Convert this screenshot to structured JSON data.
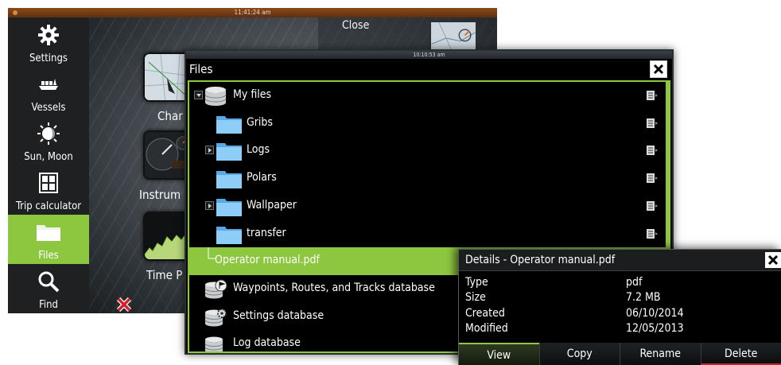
{
  "background_screen": {
    "clock": "11:41:24 am",
    "close_label": "Close",
    "sidebar": [
      {
        "label": "Settings",
        "icon": "gear-icon"
      },
      {
        "label": "Vessels",
        "icon": "vessels-icon"
      },
      {
        "label": "Sun, Moon",
        "icon": "sun-moon-icon"
      },
      {
        "label": "Trip calculator",
        "icon": "calculator-icon"
      },
      {
        "label": "Files",
        "icon": "folder-icon",
        "active": true
      },
      {
        "label": "Find",
        "icon": "search-icon"
      }
    ],
    "tiles": [
      {
        "label": "Char",
        "icon": "chart-tile-icon"
      },
      {
        "label": "Instrum",
        "icon": "instruments-tile-icon"
      },
      {
        "label": "Time P",
        "icon": "timeplot-tile-icon"
      }
    ]
  },
  "files_window": {
    "clock": "10:10:53 am",
    "title": "Files",
    "items": [
      {
        "name": "My files",
        "icon": "database-icon",
        "expander": "open",
        "menu": true
      },
      {
        "name": "Gribs",
        "icon": "folder-icon",
        "expander": "none",
        "menu": true
      },
      {
        "name": "Logs",
        "icon": "folder-icon",
        "expander": "closed",
        "menu": true
      },
      {
        "name": "Polars",
        "icon": "folder-icon",
        "expander": "none",
        "menu": true
      },
      {
        "name": "Wallpaper",
        "icon": "folder-icon",
        "expander": "closed",
        "menu": true
      },
      {
        "name": "transfer",
        "icon": "folder-icon",
        "expander": "none",
        "menu": true
      },
      {
        "name": "Operator manual.pdf",
        "icon": "none",
        "expander": "none",
        "menu": false,
        "selected": true
      },
      {
        "name": "Waypoints, Routes, and Tracks database",
        "icon": "waypoint-database-icon",
        "expander": "none",
        "menu": false
      },
      {
        "name": "Settings database",
        "icon": "settings-database-icon",
        "expander": "none",
        "menu": false
      },
      {
        "name": "Log database",
        "icon": "database-icon",
        "expander": "none",
        "menu": false
      }
    ]
  },
  "details": {
    "title": "Details - Operator manual.pdf",
    "rows": [
      {
        "key": "Type",
        "value": "pdf"
      },
      {
        "key": "Size",
        "value": "7.2 MB"
      },
      {
        "key": "Created",
        "value": "06/10/2014"
      },
      {
        "key": "Modified",
        "value": "12/05/2013"
      }
    ],
    "buttons": [
      "View",
      "Copy",
      "Rename",
      "Delete"
    ]
  },
  "colors": {
    "accent_green": "#8dc63f",
    "delete_red": "#c0282d",
    "panel_black": "#000000"
  }
}
